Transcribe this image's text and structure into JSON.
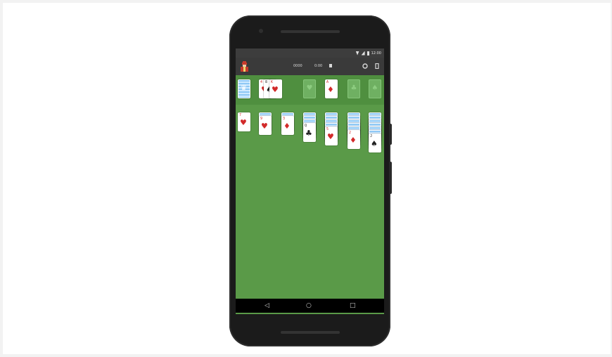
{
  "status_bar": {
    "time": "12:00"
  },
  "toolbar": {
    "score": "0000",
    "timer": "0:00"
  },
  "colors": {
    "felt": "#5a9a48",
    "foundation_row": "#4f8f3f",
    "card_red": "#d22a2a",
    "card_black": "#222222",
    "card_back": "#8ec8f5"
  },
  "icons": {
    "king": "king-avatar-icon",
    "settings": "settings-icon",
    "menu": "menu-icon",
    "back": "back-icon",
    "home": "home-icon",
    "recents": "recents-icon"
  },
  "nav": {
    "back_glyph": "◁",
    "home_glyph": "○",
    "recents_glyph": "□"
  },
  "stock": {
    "glyph": "♛"
  },
  "waste": [
    {
      "rank": "4",
      "suit": "♥",
      "color": "red"
    },
    {
      "rank": "8",
      "suit": "♠",
      "color": "black"
    },
    {
      "rank": "K",
      "suit": "♥",
      "color": "red"
    }
  ],
  "foundations": [
    {
      "glyph": "♥"
    },
    {
      "rank": "A",
      "suit": "♦",
      "color": "red"
    },
    {
      "glyph": "♣"
    },
    {
      "glyph": "♠"
    }
  ],
  "tableau": [
    {
      "hidden": 0,
      "top": {
        "rank": "7",
        "suit": "♥",
        "color": "red"
      }
    },
    {
      "hidden": 1,
      "top": {
        "rank": "9",
        "suit": "♥",
        "color": "red"
      }
    },
    {
      "hidden": 1,
      "top": {
        "rank": "3",
        "suit": "♦",
        "color": "red"
      }
    },
    {
      "hidden": 3,
      "top": {
        "rank": "Q",
        "suit": "♣",
        "color": "black"
      }
    },
    {
      "hidden": 4,
      "top": {
        "rank": "5",
        "suit": "♥",
        "color": "red"
      }
    },
    {
      "hidden": 5,
      "top": {
        "rank": "2",
        "suit": "♦",
        "color": "red"
      }
    },
    {
      "hidden": 6,
      "top": {
        "rank": "J",
        "suit": "♠",
        "color": "black"
      }
    }
  ]
}
